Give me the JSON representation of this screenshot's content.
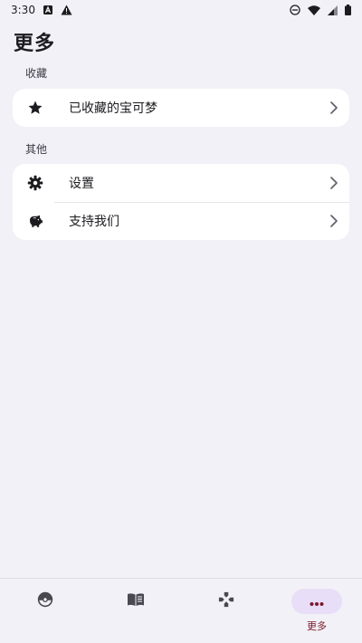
{
  "status_bar": {
    "time": "3:30",
    "left_icons": [
      "font-a-icon",
      "warning-icon"
    ],
    "right_icons": [
      "do-not-disturb-icon",
      "wifi-icon",
      "signal-icon",
      "battery-icon"
    ]
  },
  "page": {
    "title": "更多"
  },
  "sections": [
    {
      "header": "收藏",
      "items": [
        {
          "icon": "star-icon",
          "label": "已收藏的宝可梦"
        }
      ]
    },
    {
      "header": "其他",
      "items": [
        {
          "icon": "gear-icon",
          "label": "设置"
        },
        {
          "icon": "piggy-bank-icon",
          "label": "支持我们"
        }
      ]
    }
  ],
  "bottom_nav": {
    "items": [
      {
        "icon": "pokeball-icon",
        "label": ""
      },
      {
        "icon": "book-icon",
        "label": ""
      },
      {
        "icon": "gamepad-icon",
        "label": ""
      },
      {
        "icon": "more-dots-icon",
        "label": "更多",
        "active": true
      }
    ]
  },
  "colors": {
    "background": "#f2f1f7",
    "card": "#ffffff",
    "active_pill": "#e8def8",
    "active_label": "#7a1a2c"
  }
}
